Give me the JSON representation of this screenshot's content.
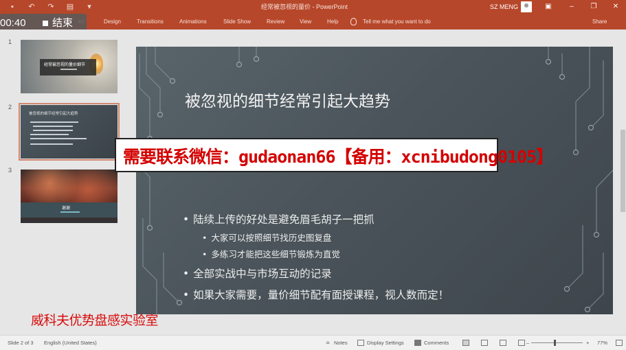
{
  "titlebar": {
    "doc_title": "经常被忽视的量价",
    "app_name": "PowerPoint",
    "user_name": "SZ MENG",
    "minimize": "–",
    "restore": "❐",
    "close": "✕",
    "ribbon_display": "▣"
  },
  "qat": {
    "save": "▪",
    "undo": "↶",
    "redo": "↷",
    "present": "▤",
    "customize": "▾"
  },
  "ribbon": {
    "tabs": [
      "ert",
      "Design",
      "Transitions",
      "Animations",
      "Slide Show",
      "Review",
      "View",
      "Help"
    ],
    "tell_me": "Tell me what you want to do",
    "share": "Share"
  },
  "recording": {
    "time": "00:40",
    "end_label": "结束"
  },
  "thumbnails": {
    "numbers": [
      "1",
      "2",
      "3"
    ],
    "t1_title": "经常被忽视的量价细节",
    "t2_title": "被忽视的细节经常引起大趋势",
    "t3_title": "谢谢"
  },
  "slide": {
    "title": "被忽视的细节经常引起大趋势",
    "bullets": [
      {
        "level": 1,
        "text": "陆续上传的好处是避免眉毛胡子一把抓"
      },
      {
        "level": 2,
        "text": "大家可以按照细节找历史图复盘"
      },
      {
        "level": 2,
        "text": "多练习才能把这些细节锻炼为直觉"
      },
      {
        "level": 1,
        "text": "全部实战中与市场互动的记录"
      },
      {
        "level": 1,
        "text": "如果大家需要，量价细节配有面授课程，视人数而定！"
      }
    ],
    "bullet_glyph": "•"
  },
  "overlay": {
    "banner": "需要联系微信：gudaonan66【备用：xcnibudong0105】",
    "lab": "威科夫优势盘感实验室"
  },
  "statusbar": {
    "slide_info": "Slide 2 of 3",
    "language": "English (United States)",
    "notes": "Notes",
    "display_settings": "Display Settings",
    "comments": "Comments",
    "zoom_minus": "–",
    "zoom_plus": "+",
    "zoom": "77%"
  },
  "colors": {
    "accent": "#b7472a",
    "banner_text": "#d40000",
    "lab_text": "#d80d0d"
  }
}
